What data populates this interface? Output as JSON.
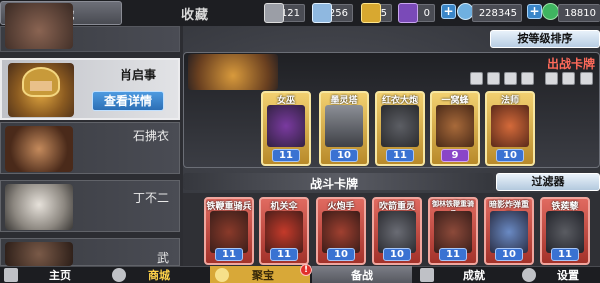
{
  "colors": {
    "accent": "#3a86c8",
    "gold": "#f2d070",
    "red": "#a3322a",
    "title": "#ff6a5a"
  },
  "top": {
    "tabs": [
      {
        "label": "备战",
        "active": true
      },
      {
        "label": "收藏",
        "active": false
      }
    ],
    "resources": [
      {
        "icon": "energy-bottle-icon",
        "value": "121"
      },
      {
        "icon": "gem-icon",
        "value": "256"
      },
      {
        "icon": "key-icon",
        "value": "5"
      },
      {
        "icon": "purple-card-icon",
        "value": "0"
      },
      {
        "icon": "gold-coin-icon",
        "value": "228345"
      },
      {
        "icon": "green-coin-icon",
        "value": "18810"
      }
    ]
  },
  "heroes": [
    {
      "name": ""
    },
    {
      "name": "肖启事",
      "detail_label": "查看详情"
    },
    {
      "name": "石拂衣"
    },
    {
      "name": "丁不二"
    },
    {
      "name": "武"
    }
  ],
  "panel": {
    "sort_label": "按等级排序",
    "battle_title": "出战卡牌",
    "combat_title": "战斗卡牌",
    "filter_label": "过滤器"
  },
  "battle_cards": [
    {
      "name": "女巫",
      "level": "11",
      "color": "gold",
      "lvl_color": "blue"
    },
    {
      "name": "墨灵塔",
      "level": "10",
      "color": "gold",
      "lvl_color": "blue"
    },
    {
      "name": "红衣大炮",
      "level": "11",
      "color": "gold",
      "lvl_color": "blue"
    },
    {
      "name": "一窝蜂",
      "level": "9",
      "color": "gold",
      "lvl_color": "purple"
    },
    {
      "name": "法师",
      "level": "10",
      "color": "gold",
      "lvl_color": "blue"
    }
  ],
  "combat_cards": [
    {
      "name": "铁鞭重骑兵",
      "level": "11",
      "color": "red",
      "lvl_color": "blue"
    },
    {
      "name": "机关伞",
      "level": "11",
      "color": "red",
      "lvl_color": "blue"
    },
    {
      "name": "火炮手",
      "level": "10",
      "color": "red",
      "lvl_color": "blue"
    },
    {
      "name": "吹箭重灵",
      "level": "10",
      "color": "red",
      "lvl_color": "blue"
    },
    {
      "name": "御林铁鞭重骑兵",
      "level": "11",
      "color": "red",
      "lvl_color": "blue"
    },
    {
      "name": "暗影炸弹重灵",
      "level": "10",
      "color": "red",
      "lvl_color": "blue"
    },
    {
      "name": "铁蒺藜",
      "level": "11",
      "color": "red",
      "lvl_color": "blue"
    }
  ],
  "bottom": {
    "tabs": [
      "主页",
      "商城",
      "聚宝",
      "备战",
      "成就",
      "设置"
    ],
    "badge": "!"
  }
}
